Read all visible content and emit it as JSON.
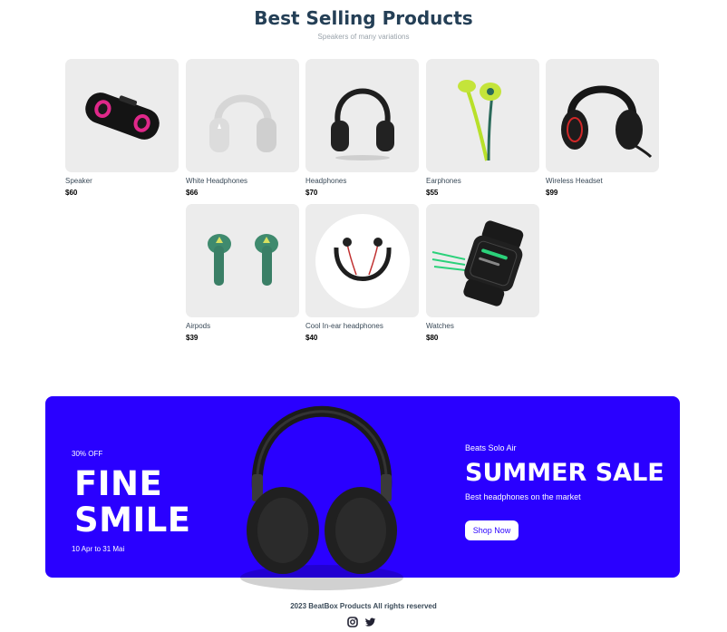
{
  "header": {
    "title": "Best Selling Products",
    "subtitle": "Speakers of many variations"
  },
  "products": [
    {
      "name": "Speaker",
      "price": "$60",
      "icon": "speaker-icon"
    },
    {
      "name": "White Headphones",
      "price": "$66",
      "icon": "white-headphones-icon"
    },
    {
      "name": "Headphones",
      "price": "$70",
      "icon": "headphones-icon"
    },
    {
      "name": "Earphones",
      "price": "$55",
      "icon": "earphones-icon"
    },
    {
      "name": "Wireless Headset",
      "price": "$99",
      "icon": "headset-icon"
    },
    {
      "name": "Airpods",
      "price": "$39",
      "icon": "airpods-icon"
    },
    {
      "name": "Cool In-ear headphones",
      "price": "$40",
      "icon": "neckband-icon"
    },
    {
      "name": "Watches",
      "price": "$80",
      "icon": "smartwatch-icon"
    }
  ],
  "banner": {
    "discount": "30% OFF",
    "headline_line1": "FINE",
    "headline_line2": "SMILE",
    "date_range": "10 Apr to 31 Mai",
    "product_name": "Beats Solo Air",
    "sale_title": "SUMMER SALE",
    "description": "Best headphones on the market",
    "cta_label": "Shop Now",
    "accent_color": "#2a00ff"
  },
  "footer": {
    "copyright": "2023 BeatBox Products All rights reserved",
    "social": [
      "instagram-icon",
      "twitter-icon"
    ]
  }
}
